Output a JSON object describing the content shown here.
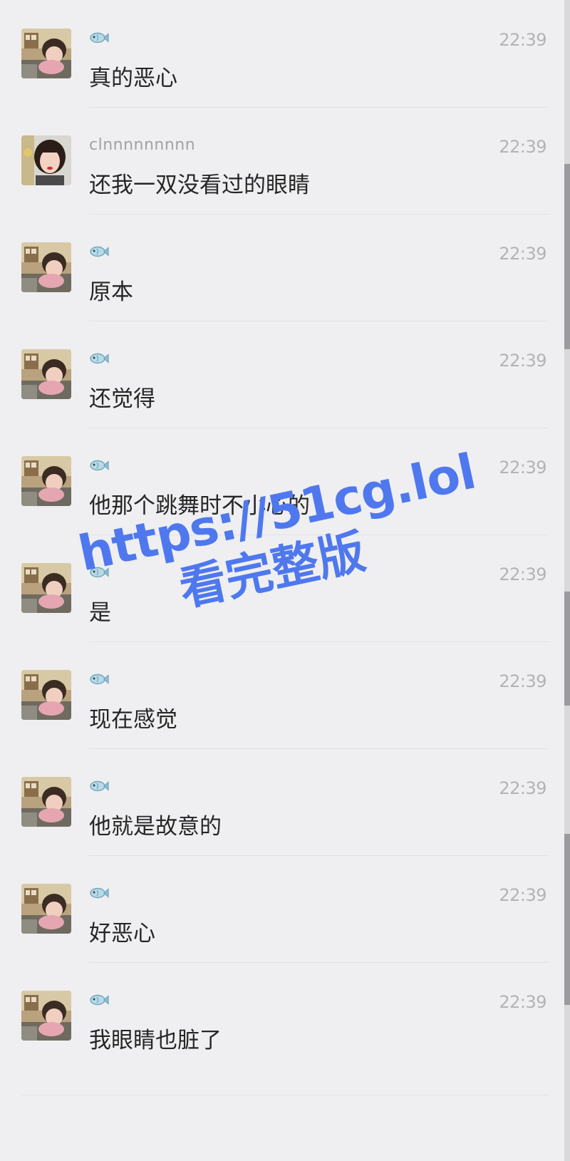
{
  "messages": [
    {
      "sender": "fish",
      "text": "真的恶心",
      "time": "22:39"
    },
    {
      "sender": "clnnnnnnnnn",
      "text": "还我一双没看过的眼睛",
      "time": "22:39"
    },
    {
      "sender": "fish",
      "text": "原本",
      "time": "22:39"
    },
    {
      "sender": "fish",
      "text": "还觉得",
      "time": "22:39"
    },
    {
      "sender": "fish",
      "text": "他那个跳舞时不小心的",
      "time": "22:39"
    },
    {
      "sender": "fish",
      "text": "是",
      "time": "22:39"
    },
    {
      "sender": "fish",
      "text": "现在感觉",
      "time": "22:39"
    },
    {
      "sender": "fish",
      "text": "他就是故意的",
      "time": "22:39"
    },
    {
      "sender": "fish",
      "text": "好恶心",
      "time": "22:39"
    },
    {
      "sender": "fish",
      "text": "我眼睛也脏了",
      "time": "22:39"
    }
  ],
  "icons": {
    "fish_name": "fish-icon",
    "avatar_child": "child-avatar",
    "avatar_girl": "girl-avatar"
  },
  "watermark": {
    "url": "https://51cg.lol",
    "subtitle": "看完整版",
    "color": "#4f78ef"
  },
  "colors": {
    "background": "#efeff1",
    "name_text": "#a2a2a6",
    "time_text": "#b3b3b7",
    "message_text": "#262626"
  }
}
